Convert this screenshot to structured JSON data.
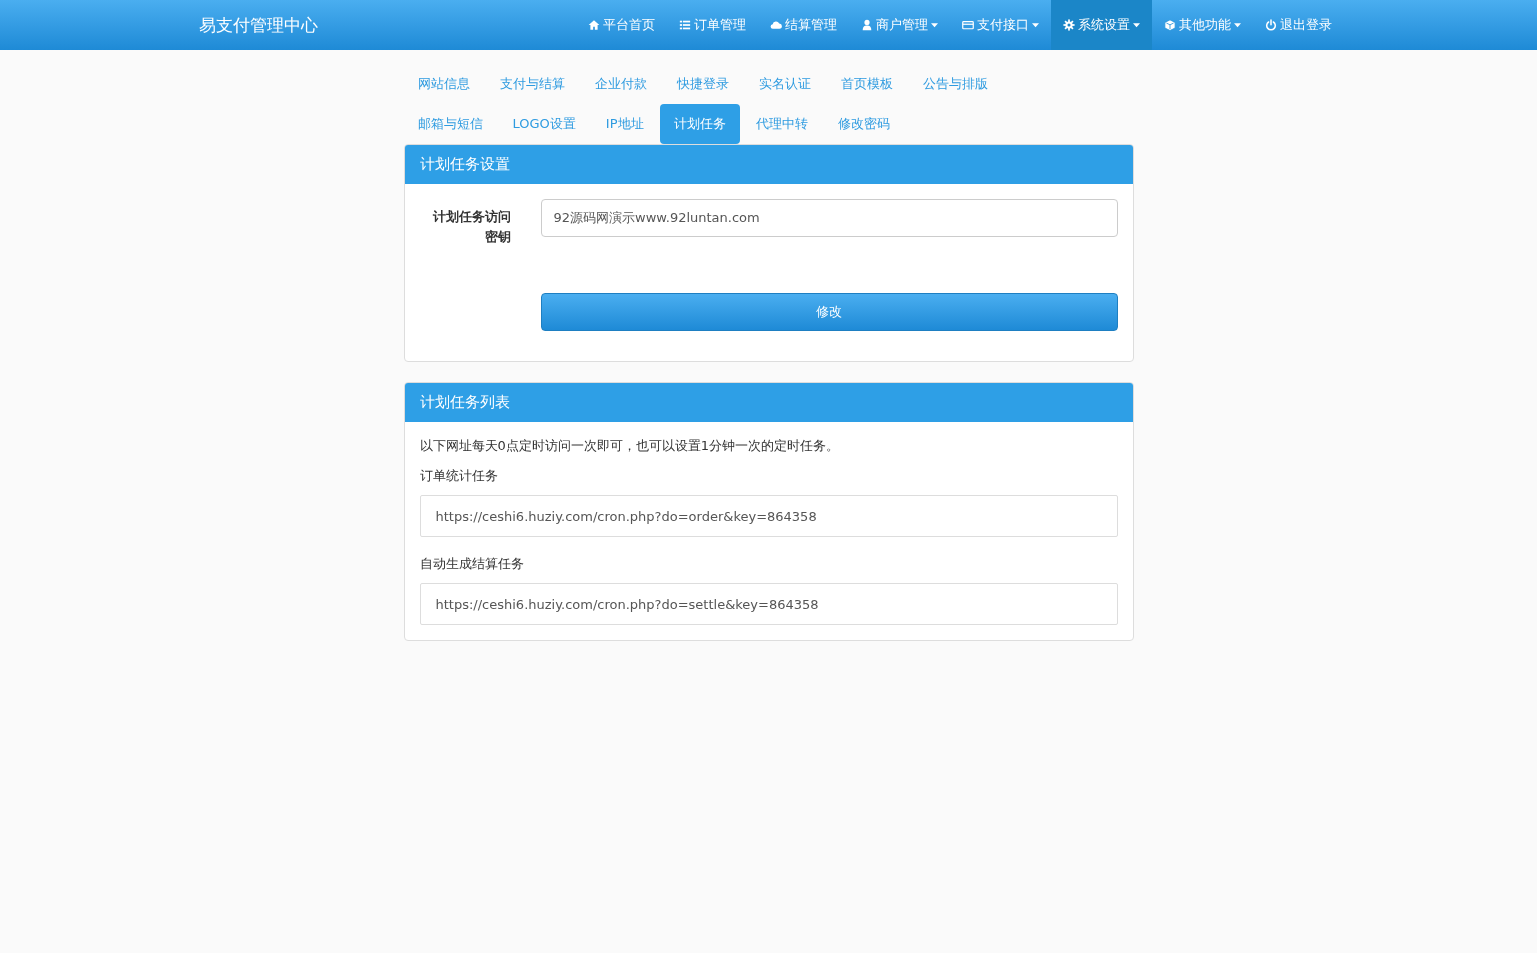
{
  "navbar": {
    "brand": "易支付管理中心",
    "items": [
      {
        "kind": "home",
        "label": "平台首页",
        "caret": false,
        "selected": false
      },
      {
        "kind": "list",
        "label": "订单管理",
        "caret": false,
        "selected": false
      },
      {
        "kind": "cloud",
        "label": "结算管理",
        "caret": false,
        "selected": false
      },
      {
        "kind": "user",
        "label": "商户管理",
        "caret": true,
        "selected": false
      },
      {
        "kind": "card",
        "label": "支付接口",
        "caret": true,
        "selected": false
      },
      {
        "kind": "gear",
        "label": "系统设置",
        "caret": true,
        "selected": true
      },
      {
        "kind": "cube",
        "label": "其他功能",
        "caret": true,
        "selected": false
      },
      {
        "kind": "power",
        "label": "退出登录",
        "caret": false,
        "selected": false
      }
    ]
  },
  "tabs": [
    {
      "label": "网站信息",
      "selected": false
    },
    {
      "label": "支付与结算",
      "selected": false
    },
    {
      "label": "企业付款",
      "selected": false
    },
    {
      "label": "快捷登录",
      "selected": false
    },
    {
      "label": "实名认证",
      "selected": false
    },
    {
      "label": "首页模板",
      "selected": false
    },
    {
      "label": "公告与排版",
      "selected": false
    },
    {
      "label": "邮箱与短信",
      "selected": false
    },
    {
      "label": "LOGO设置",
      "selected": false
    },
    {
      "label": "IP地址",
      "selected": false
    },
    {
      "label": "计划任务",
      "selected": true
    },
    {
      "label": "代理中转",
      "selected": false
    },
    {
      "label": "修改密码",
      "selected": false
    }
  ],
  "settings_panel": {
    "title": "计划任务设置",
    "field_label": "计划任务访问密钥",
    "field_value": "92源码网演示www.92luntan.com",
    "submit": "修改"
  },
  "list_panel": {
    "title": "计划任务列表",
    "note": "以下网址每天0点定时访问一次即可，也可以设置1分钟一次的定时任务。",
    "tasks": [
      {
        "label": "订单统计任务",
        "url": "https://ceshi6.huziy.com/cron.php?do=order&key=864358"
      },
      {
        "label": "自动生成结算任务",
        "url": "https://ceshi6.huziy.com/cron.php?do=settle&key=864358"
      }
    ]
  }
}
